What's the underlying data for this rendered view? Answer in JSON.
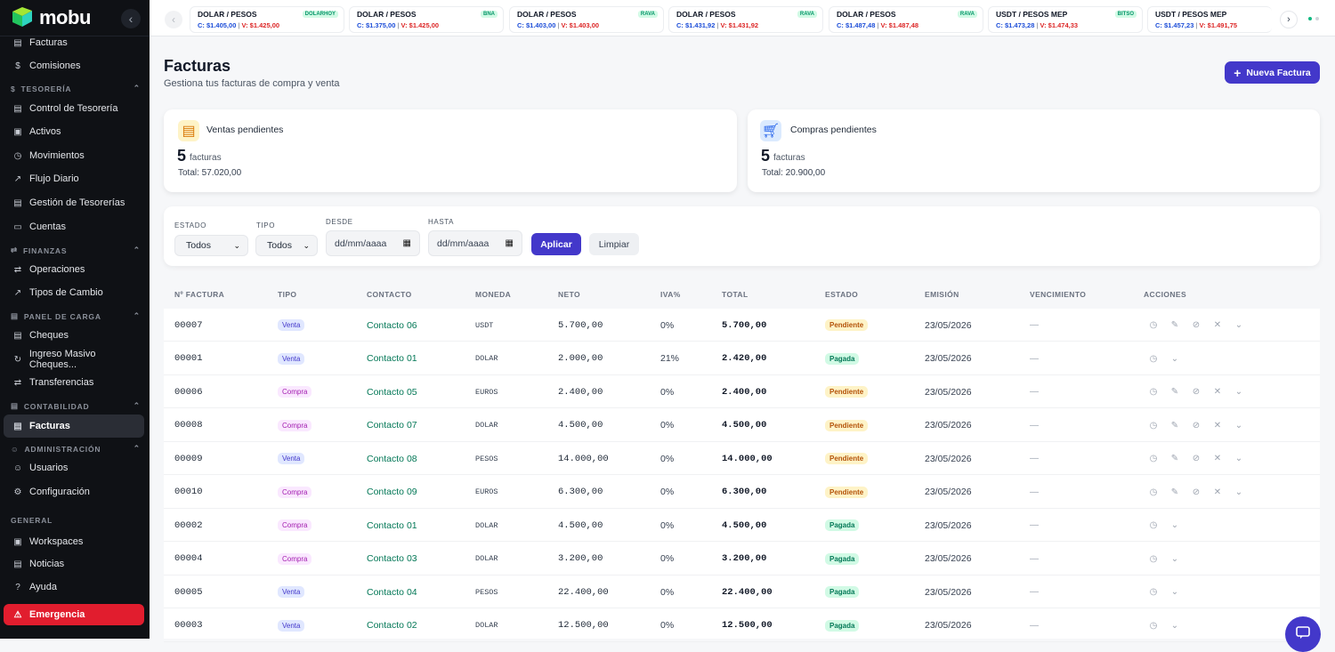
{
  "brand": {
    "name": "mobu",
    "accent": "#4338ca"
  },
  "sidebar": {
    "items": [
      {
        "id": "facturas-top",
        "label": "Facturas",
        "icon": "document-icon"
      },
      {
        "id": "comisiones",
        "label": "Comisiones",
        "icon": "dollar-icon"
      },
      {
        "id": "control-tesoreria",
        "label": "Control de Tesorería",
        "icon": "document-icon"
      },
      {
        "id": "activos",
        "label": "Activos",
        "icon": "briefcase-icon"
      },
      {
        "id": "movimientos",
        "label": "Movimientos",
        "icon": "clock-icon"
      },
      {
        "id": "flujo-diario",
        "label": "Flujo Diario",
        "icon": "trend-icon"
      },
      {
        "id": "gestion-tesorerias",
        "label": "Gestión de Tesorerías",
        "icon": "document-icon"
      },
      {
        "id": "cuentas",
        "label": "Cuentas",
        "icon": "card-icon"
      },
      {
        "id": "operaciones",
        "label": "Operaciones",
        "icon": "swap-icon"
      },
      {
        "id": "tipos-cambio",
        "label": "Tipos de Cambio",
        "icon": "trend-icon"
      },
      {
        "id": "cheques",
        "label": "Cheques",
        "icon": "document-icon"
      },
      {
        "id": "ingreso-masivo",
        "label": "Ingreso Masivo Cheques...",
        "icon": "refresh-icon"
      },
      {
        "id": "transferencias",
        "label": "Transferencias",
        "icon": "swap-icon"
      },
      {
        "id": "facturas",
        "label": "Facturas",
        "icon": "document-icon"
      },
      {
        "id": "usuarios",
        "label": "Usuarios",
        "icon": "users-icon"
      },
      {
        "id": "configuracion",
        "label": "Configuración",
        "icon": "gear-icon"
      },
      {
        "id": "workspaces",
        "label": "Workspaces",
        "icon": "briefcase-icon"
      },
      {
        "id": "noticias",
        "label": "Noticias",
        "icon": "news-icon"
      },
      {
        "id": "ayuda",
        "label": "Ayuda",
        "icon": "help-icon"
      },
      {
        "id": "emergencia",
        "label": "Emergencia",
        "icon": "alert-icon"
      }
    ],
    "sections": [
      "TESORERÍA",
      "FINANZAS",
      "PANEL DE CARGA",
      "CONTABILIDAD",
      "ADMINISTRACIÓN",
      "GENERAL"
    ]
  },
  "rates": [
    {
      "pair": "DOLAR / PESOS",
      "source": "DOLARHOY",
      "buy": "C: $1.405,00",
      "sell": "V: $1.425,00"
    },
    {
      "pair": "DOLAR / PESOS",
      "source": "BNA",
      "buy": "C: $1.375,00",
      "sell": "V: $1.425,00"
    },
    {
      "pair": "DOLAR / PESOS",
      "source": "RAVA",
      "buy": "C: $1.403,00",
      "sell": "V: $1.403,00"
    },
    {
      "pair": "DOLAR / PESOS",
      "source": "RAVA",
      "buy": "C: $1.431,92",
      "sell": "V: $1.431,92"
    },
    {
      "pair": "DOLAR / PESOS",
      "source": "RAVA",
      "buy": "C: $1.487,48",
      "sell": "V: $1.487,48"
    },
    {
      "pair": "USDT / PESOS MEP",
      "source": "BITSO",
      "buy": "C: $1.473,28",
      "sell": "V: $1.474,33"
    },
    {
      "pair": "USDT / PESOS MEP",
      "source": "",
      "buy": "C: $1.457,23",
      "sell": "V: $1.491,75"
    }
  ],
  "page": {
    "title": "Facturas",
    "subtitle": "Gestiona tus facturas de compra y venta",
    "new_button": "Nueva Factura"
  },
  "cards": {
    "ventas": {
      "title": "Ventas pendientes",
      "count": "5",
      "unit": "facturas",
      "total": "Total: 57.020,00"
    },
    "compras": {
      "title": "Compras pendientes",
      "count": "5",
      "unit": "facturas",
      "total": "Total: 20.900,00"
    }
  },
  "filters": {
    "estado_label": "ESTADO",
    "estado_value": "Todos",
    "tipo_label": "TIPO",
    "tipo_value": "Todos",
    "desde_label": "DESDE",
    "desde_placeholder": "dd/mm/aaaa",
    "hasta_label": "HASTA",
    "hasta_placeholder": "dd/mm/aaaa",
    "apply": "Aplicar",
    "clear": "Limpiar"
  },
  "table": {
    "headers": [
      "Nº FACTURA",
      "TIPO",
      "CONTACTO",
      "MONEDA",
      "NETO",
      "IVA%",
      "TOTAL",
      "ESTADO",
      "EMISIÓN",
      "VENCIMIENTO",
      "ACCIONES"
    ],
    "rows": [
      {
        "num": "00007",
        "tipo": "Venta",
        "contacto": "Contacto 06",
        "moneda": "USDT",
        "neto": "5.700,00",
        "iva": "0%",
        "total": "5.700,00",
        "estado": "Pendiente",
        "emision": "23/05/2026",
        "venc": "—"
      },
      {
        "num": "00001",
        "tipo": "Venta",
        "contacto": "Contacto 01",
        "moneda": "DOLAR",
        "neto": "2.000,00",
        "iva": "21%",
        "total": "2.420,00",
        "estado": "Pagada",
        "emision": "23/05/2026",
        "venc": "—"
      },
      {
        "num": "00006",
        "tipo": "Compra",
        "contacto": "Contacto 05",
        "moneda": "EUROS",
        "neto": "2.400,00",
        "iva": "0%",
        "total": "2.400,00",
        "estado": "Pendiente",
        "emision": "23/05/2026",
        "venc": "—"
      },
      {
        "num": "00008",
        "tipo": "Compra",
        "contacto": "Contacto 07",
        "moneda": "DOLAR",
        "neto": "4.500,00",
        "iva": "0%",
        "total": "4.500,00",
        "estado": "Pendiente",
        "emision": "23/05/2026",
        "venc": "—"
      },
      {
        "num": "00009",
        "tipo": "Venta",
        "contacto": "Contacto 08",
        "moneda": "PESOS",
        "neto": "14.000,00",
        "iva": "0%",
        "total": "14.000,00",
        "estado": "Pendiente",
        "emision": "23/05/2026",
        "venc": "—"
      },
      {
        "num": "00010",
        "tipo": "Compra",
        "contacto": "Contacto 09",
        "moneda": "EUROS",
        "neto": "6.300,00",
        "iva": "0%",
        "total": "6.300,00",
        "estado": "Pendiente",
        "emision": "23/05/2026",
        "venc": "—"
      },
      {
        "num": "00002",
        "tipo": "Compra",
        "contacto": "Contacto 01",
        "moneda": "DOLAR",
        "neto": "4.500,00",
        "iva": "0%",
        "total": "4.500,00",
        "estado": "Pagada",
        "emision": "23/05/2026",
        "venc": "—"
      },
      {
        "num": "00004",
        "tipo": "Compra",
        "contacto": "Contacto 03",
        "moneda": "DOLAR",
        "neto": "3.200,00",
        "iva": "0%",
        "total": "3.200,00",
        "estado": "Pagada",
        "emision": "23/05/2026",
        "venc": "—"
      },
      {
        "num": "00005",
        "tipo": "Venta",
        "contacto": "Contacto 04",
        "moneda": "PESOS",
        "neto": "22.400,00",
        "iva": "0%",
        "total": "22.400,00",
        "estado": "Pagada",
        "emision": "23/05/2026",
        "venc": "—"
      },
      {
        "num": "00003",
        "tipo": "Venta",
        "contacto": "Contacto 02",
        "moneda": "DOLAR",
        "neto": "12.500,00",
        "iva": "0%",
        "total": "12.500,00",
        "estado": "Pagada",
        "emision": "23/05/2026",
        "venc": "—"
      }
    ]
  }
}
